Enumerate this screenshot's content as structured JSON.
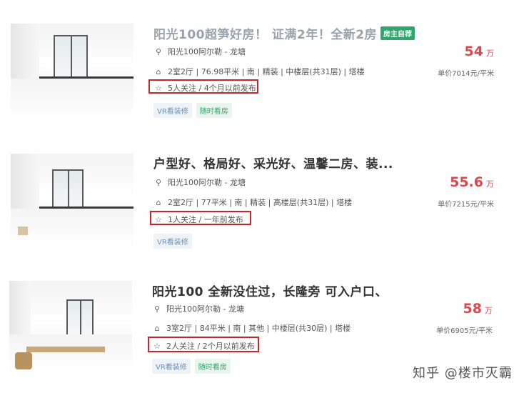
{
  "listings": [
    {
      "title": "阳光100超笋好房！ 证满2年！全新2房 ...",
      "badge": "房主自荐",
      "community": "阳光100阿尔勒 - 龙塘",
      "info": "2室2厅 | 76.98平米 | 南 | 精装 | 中楼层(共31层) | 塔楼",
      "follow": "5人关注 / 4个月以前发布",
      "tags": [
        "VR看装修",
        "随时看房"
      ],
      "price": "54",
      "price_unit": "万",
      "unit_price": "单价7014元/平米"
    },
    {
      "title": "户型好、格局好、采光好、温馨二房、装...",
      "community": "阳光100阿尔勒 - 龙塘",
      "info": "2室2厅 | 77平米 | 南 | 精装 | 高楼层(共31层) | 塔楼",
      "follow": "1人关注 / 一年前发布",
      "tags": [
        "VR看装修"
      ],
      "price": "55.6",
      "price_unit": "万",
      "unit_price": "单价7215元/平米"
    },
    {
      "title": "阳光100 全新没住过，长隆旁 可入户口、",
      "community": "阳光100阿尔勒 - 龙塘",
      "info": "3室2厅 | 84平米 | 南 | 其他 | 中楼层(共30层) | 塔楼",
      "follow": "2人关注 / 2个月以前发布",
      "tags": [
        "VR看装修",
        "随时看房"
      ],
      "price": "58",
      "price_unit": "万",
      "unit_price": "单价6905元/平米"
    }
  ],
  "watermark": "知乎 @楼市灭霸",
  "icons": {
    "location": "location-pin-icon",
    "house": "house-icon",
    "star": "star-icon"
  },
  "colors": {
    "price": "#e0474c",
    "highlight_box": "#c8262c",
    "badge": "#2fa66b"
  }
}
